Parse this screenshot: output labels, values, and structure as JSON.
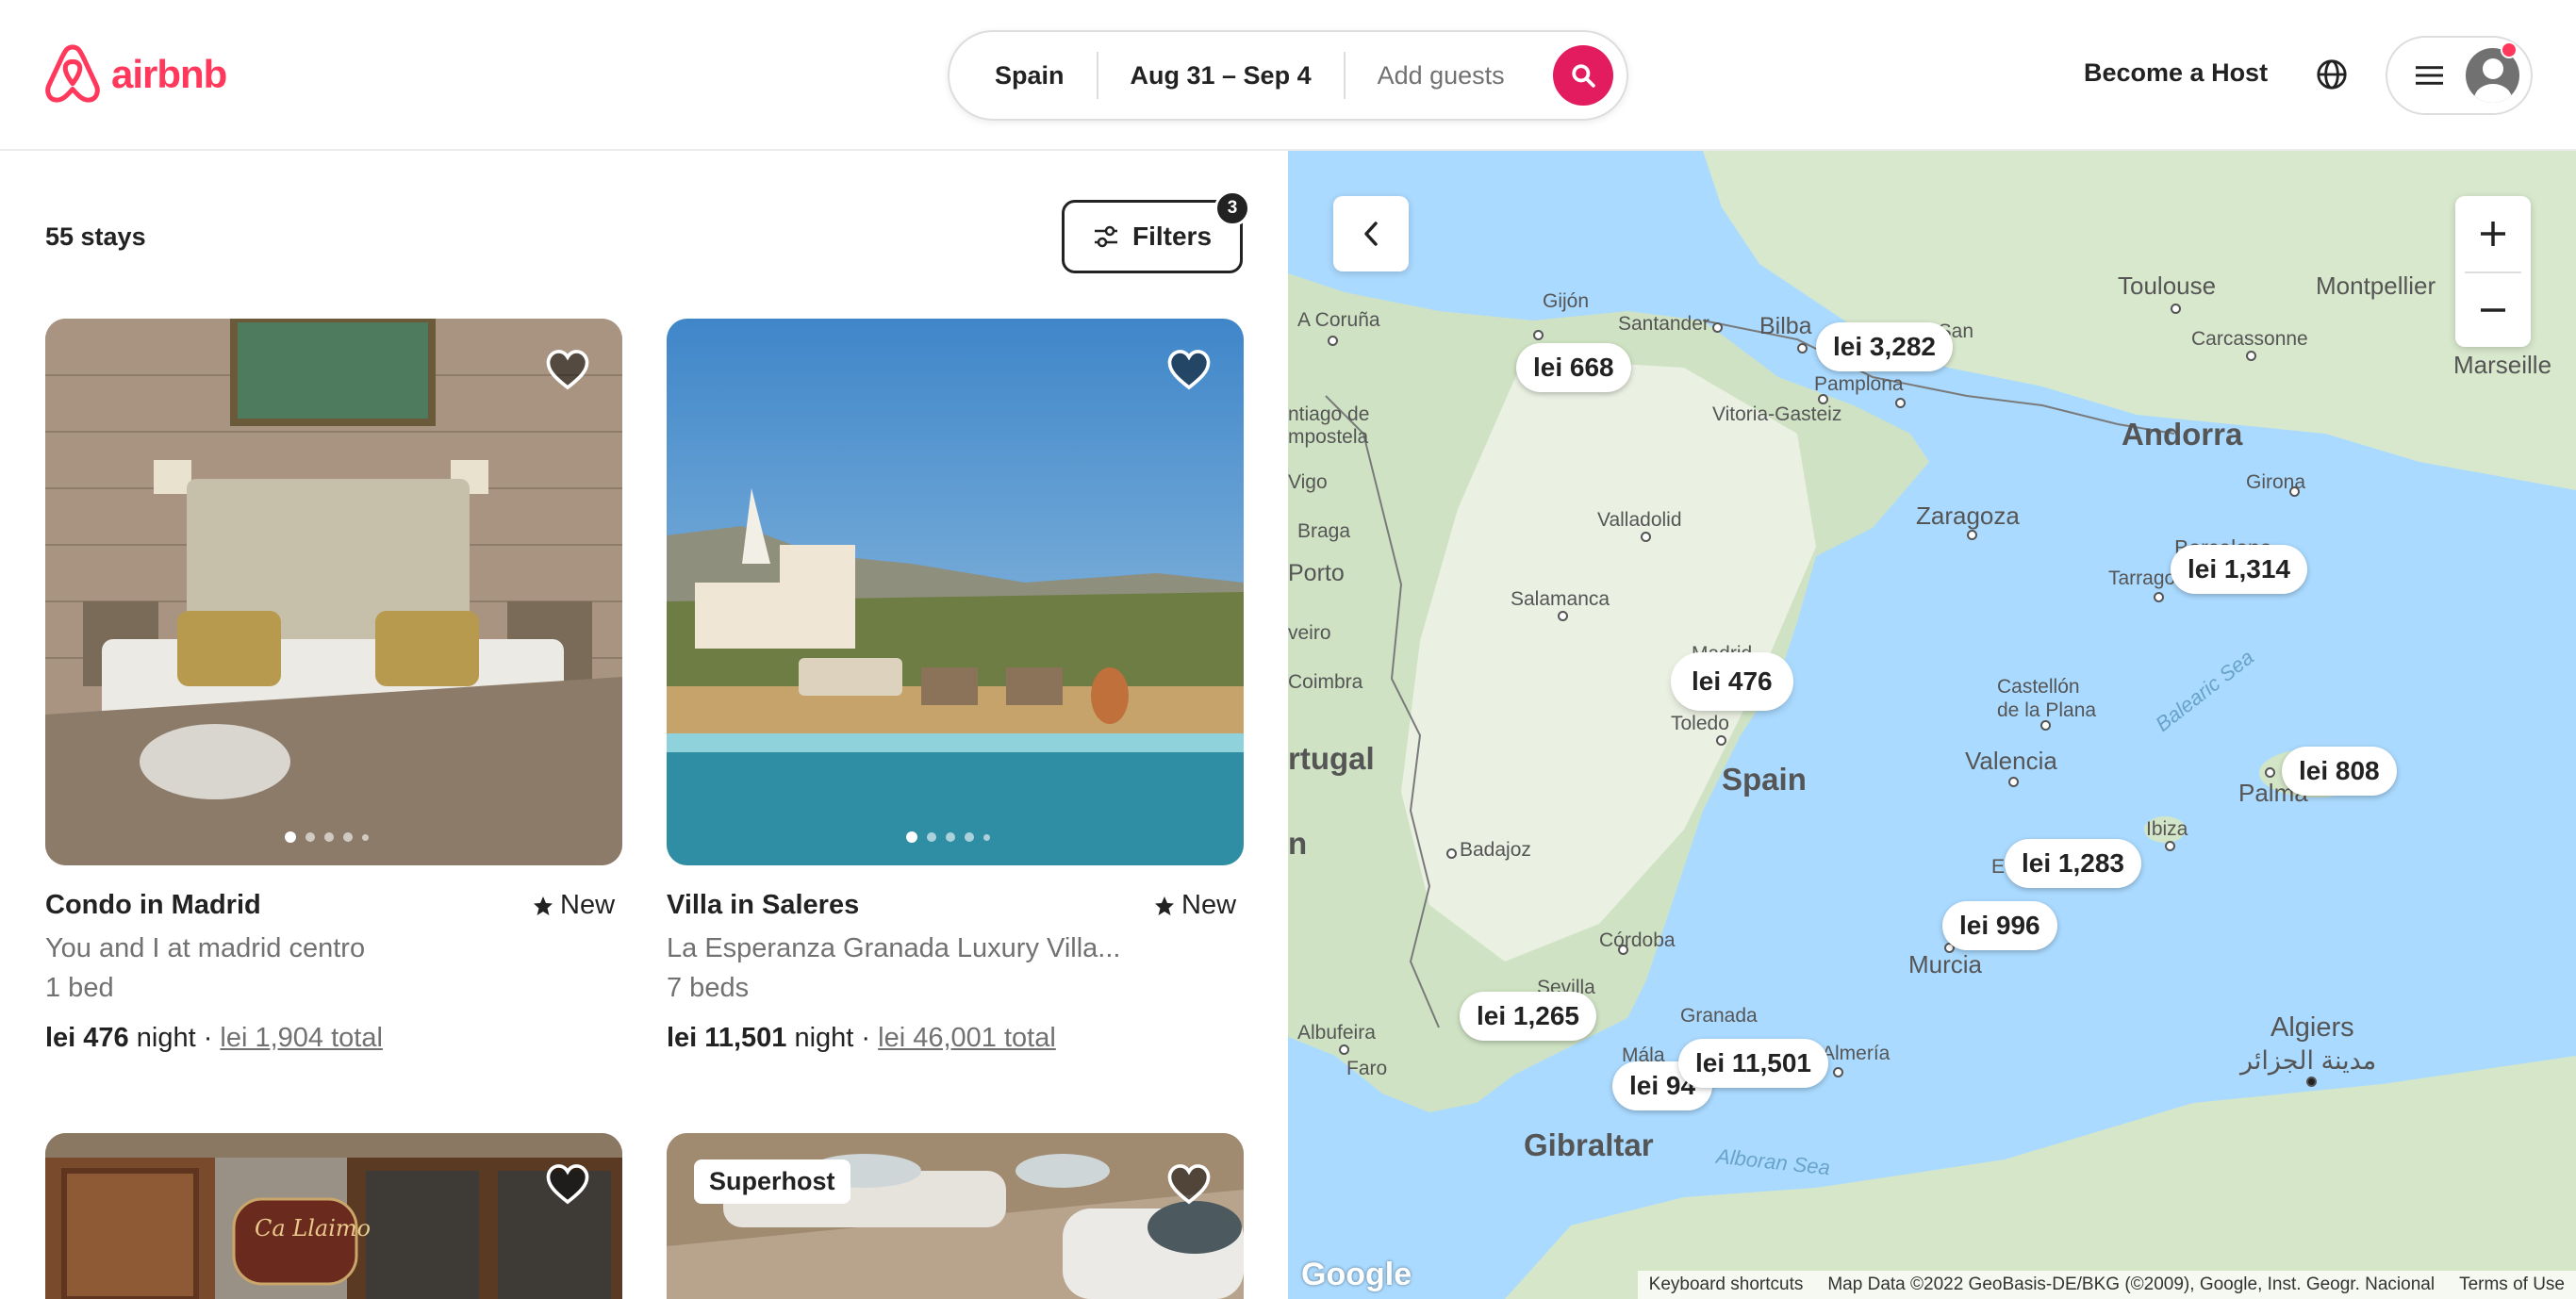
{
  "brand": {
    "name": "airbnb",
    "color": "#ff385c"
  },
  "search": {
    "location": "Spain",
    "dates": "Aug 31 – Sep 4",
    "guests_placeholder": "Add guests",
    "button_icon": "search-icon"
  },
  "header": {
    "become_host": "Become a Host",
    "globe_icon": "globe-icon",
    "menu_icon": "menu-icon",
    "avatar_icon": "user-avatar-icon"
  },
  "results": {
    "count_label": "55 stays",
    "filters_label": "Filters",
    "filters_count": "3"
  },
  "listings": [
    {
      "title": "Condo in Madrid",
      "badge": "New",
      "subtitle": "You and I at madrid centro",
      "beds": "1 bed",
      "price": "lei 476",
      "per": "night",
      "total": "lei 1,904 total",
      "dots": 5
    },
    {
      "title": "Villa in Saleres",
      "badge": "New",
      "subtitle": "La Esperanza Granada Luxury Villa...",
      "beds": "7 beds",
      "price": "lei 11,501",
      "per": "night",
      "total": "lei 46,001 total",
      "dots": 5
    },
    {
      "title": "",
      "badge": "",
      "subtitle": "",
      "beds": "",
      "price": "",
      "per": "",
      "total": "",
      "sign": "Ca Llaimo"
    },
    {
      "title": "",
      "badge": "Superhost",
      "subtitle": "",
      "beds": "",
      "price": "",
      "per": "",
      "total": ""
    }
  ],
  "map": {
    "price_pins": [
      "lei 668",
      "lei 3,282",
      "lei 1,314",
      "lei 476",
      "lei 808",
      "lei 1,283",
      "lei 996",
      "lei 1,265",
      "lei 11,501",
      "lei 94"
    ],
    "places": [
      "A Coruña",
      "Gijón",
      "Santander",
      "Bilba",
      "ctia-San",
      "Pamplona",
      "Vitoria-Gasteiz",
      "ntiago de",
      "mpostela",
      "Vigo",
      "Braga",
      "Porto",
      "veiro",
      "Coimbra",
      "rtugal",
      "n",
      "Valladolid",
      "Salamanca",
      "Madrid",
      "Toledo",
      "Spain",
      "Zaragoza",
      "Andorra",
      "Tarrago",
      "Barcelona",
      "Girona",
      "Toulouse",
      "Montpellier",
      "Carcassonne",
      "Marseille",
      "Castellón de la Plana",
      "Valencia",
      "Palma",
      "Ibiza",
      "E",
      "Badajoz",
      "Córdoba",
      "Murcia",
      "Sevilla",
      "Granada",
      "Almería",
      "Albufeira",
      "Faro",
      "Mála",
      "Gibraltar",
      "Alboran Sea",
      "Algiers",
      "مدينة الجزائر",
      "Balearic Sea"
    ],
    "footer": {
      "shortcuts": "Keyboard shortcuts",
      "attribution": "Map Data ©2022 GeoBasis-DE/BKG (©2009), Google, Inst. Geogr. Nacional",
      "terms": "Terms of Use"
    },
    "google": "Google",
    "zoom_in_icon": "plus-icon",
    "zoom_out_icon": "minus-icon",
    "back_icon": "chevron-left-icon"
  }
}
